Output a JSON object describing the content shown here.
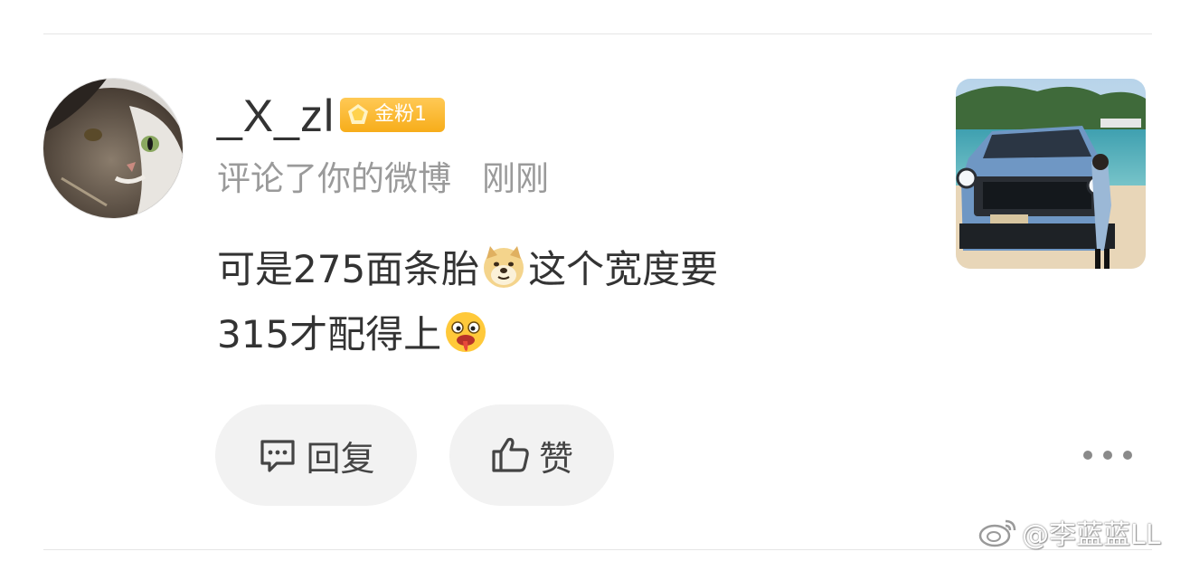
{
  "comment": {
    "username": "_X_zl",
    "badge": {
      "label": "金粉1",
      "icon": "gold-fan-badge-icon",
      "color": "#f7ad1a"
    },
    "action_text": "评论了你的微博",
    "time": "刚刚",
    "content_line1_a": "可是275面条胎",
    "emoji1": "doge-emoji-icon",
    "content_line1_b": "这个宽度要",
    "content_line2": "315才配得上",
    "emoji2": "drooling-emoji-icon"
  },
  "actions": {
    "reply_label": "回复",
    "reply_icon": "comment-bubble-icon",
    "like_label": "赞",
    "like_icon": "thumbs-up-icon",
    "more_icon": "more-dots-icon"
  },
  "watermark": {
    "text": "@李蓝蓝LL",
    "icon": "weibo-logo-icon"
  }
}
